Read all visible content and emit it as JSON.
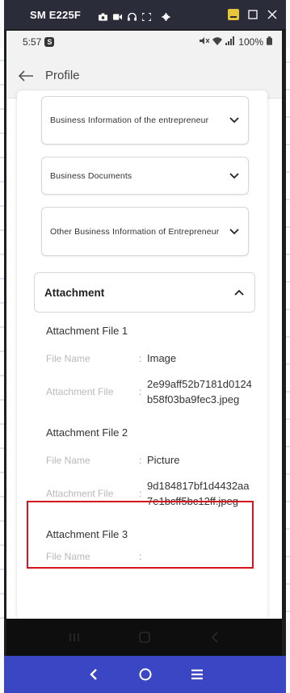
{
  "window": {
    "title": "SM E225F",
    "toolbar_icons": [
      "camera-icon",
      "video-icon",
      "headphones-icon",
      "fullscreen-icon",
      "settings-icon"
    ],
    "controls": [
      "minimize",
      "maximize",
      "close"
    ]
  },
  "statusbar": {
    "time": "5:57",
    "badge": "S",
    "battery": "100%"
  },
  "appbar": {
    "title": "Profile"
  },
  "sections": [
    {
      "label": "Business Information of the entrepreneur"
    },
    {
      "label": "Business Documents"
    },
    {
      "label": "Other Business Information of Entrepreneur"
    }
  ],
  "attachment": {
    "header": "Attachment",
    "files": [
      {
        "title": "Attachment File 1",
        "name_key": "File Name",
        "name_value": "Image",
        "file_key": "Attachment File",
        "file_value": "2e99aff52b7181d0124b58f03ba9fec3.jpeg"
      },
      {
        "title": "Attachment File 2",
        "name_key": "File Name",
        "name_value": "Picture",
        "file_key": "Attachment File",
        "file_value": "9d184817bf1d4432aa7e1bcff5bc12ff.jpeg"
      },
      {
        "title": "Attachment File 3",
        "name_key": "File Name",
        "name_value": ""
      }
    ]
  },
  "separator": ":",
  "colors": {
    "titlebar": "#2b2c39",
    "control_bar": "#3b46c4",
    "highlight": "#d4161c"
  }
}
